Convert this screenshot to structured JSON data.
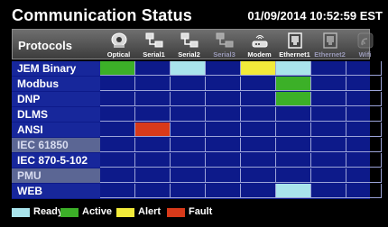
{
  "header": {
    "title": "Communication Status",
    "datetime": "01/09/2014 10:52:59 EST",
    "protocols_heading": "Protocols"
  },
  "columns": [
    {
      "label": "Optical",
      "icon": "optical-port-icon",
      "enabled": true
    },
    {
      "label": "Serial1",
      "icon": "serial-port-icon",
      "enabled": true
    },
    {
      "label": "Serial2",
      "icon": "serial-port-icon",
      "enabled": true
    },
    {
      "label": "Serial3",
      "icon": "serial-port-icon",
      "enabled": false
    },
    {
      "label": "Modem",
      "icon": "modem-icon",
      "enabled": true
    },
    {
      "label": "Ethernet1",
      "icon": "ethernet-port-icon",
      "enabled": true
    },
    {
      "label": "Ethernet2",
      "icon": "ethernet-port-icon",
      "enabled": false
    },
    {
      "label": "Wifi",
      "icon": "wifi-icon",
      "enabled": false
    }
  ],
  "rows": [
    {
      "label": "JEM Binary",
      "enabled": true,
      "status": [
        "active",
        null,
        "ready",
        null,
        "alert",
        "ready",
        null,
        null
      ]
    },
    {
      "label": "Modbus",
      "enabled": true,
      "status": [
        null,
        null,
        null,
        null,
        null,
        "active",
        null,
        null
      ]
    },
    {
      "label": "DNP",
      "enabled": true,
      "status": [
        null,
        null,
        null,
        null,
        null,
        "active",
        null,
        null
      ]
    },
    {
      "label": "DLMS",
      "enabled": true,
      "status": [
        null,
        null,
        null,
        null,
        null,
        null,
        null,
        null
      ]
    },
    {
      "label": "ANSI",
      "enabled": true,
      "status": [
        null,
        "fault",
        null,
        null,
        null,
        null,
        null,
        null
      ]
    },
    {
      "label": "IEC 61850",
      "enabled": false,
      "status": [
        null,
        null,
        null,
        null,
        null,
        null,
        null,
        null
      ]
    },
    {
      "label": "IEC 870-5-102",
      "enabled": true,
      "status": [
        null,
        null,
        null,
        null,
        null,
        null,
        null,
        null
      ]
    },
    {
      "label": "PMU",
      "enabled": false,
      "status": [
        null,
        null,
        null,
        null,
        null,
        null,
        null,
        null
      ]
    },
    {
      "label": "WEB",
      "enabled": true,
      "status": [
        null,
        null,
        null,
        null,
        null,
        "ready",
        null,
        null
      ]
    }
  ],
  "legend": [
    {
      "key": "ready",
      "label": "Ready",
      "color": "#a9e4ec"
    },
    {
      "key": "active",
      "label": "Active",
      "color": "#3cb028"
    },
    {
      "key": "alert",
      "label": "Alert",
      "color": "#f2ea3a"
    },
    {
      "key": "fault",
      "label": "Fault",
      "color": "#d83a1a"
    }
  ]
}
